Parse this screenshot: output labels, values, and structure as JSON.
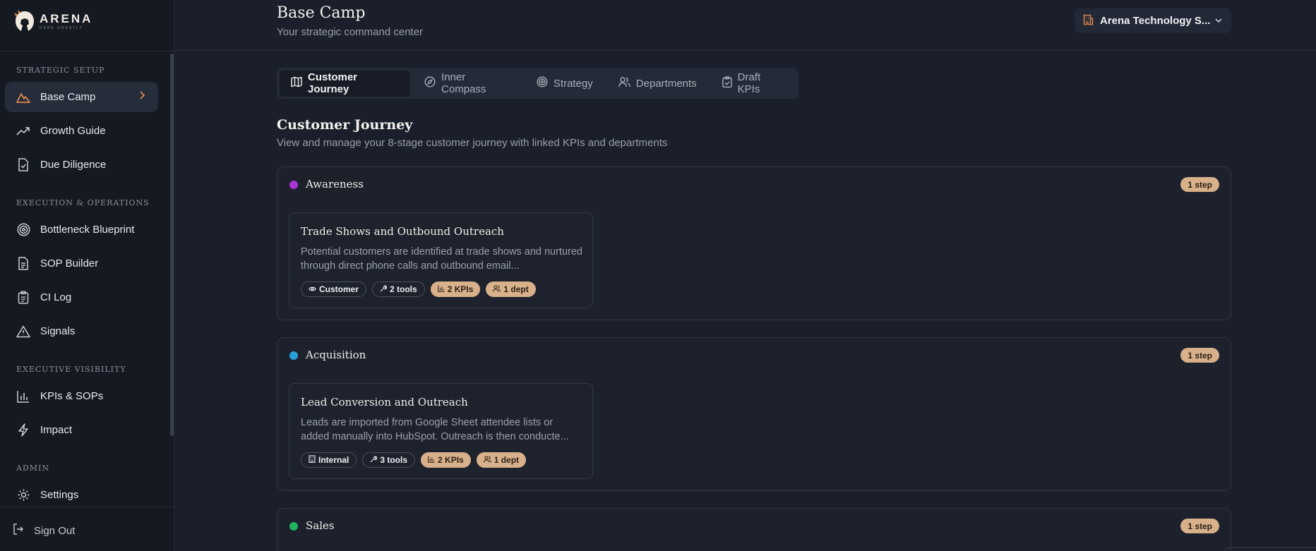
{
  "brand": {
    "name": "ARENA",
    "tagline": "DARE GREATLY"
  },
  "sidebar": {
    "sections": [
      {
        "label": "STRATEGIC SETUP"
      },
      {
        "label": "EXECUTION & OPERATIONS"
      },
      {
        "label": "EXECUTIVE VISIBILITY"
      },
      {
        "label": "ADMIN"
      }
    ],
    "items": [
      {
        "label": "Base Camp",
        "icon": "mountain-icon",
        "active": true
      },
      {
        "label": "Growth Guide",
        "icon": "trending-up-icon"
      },
      {
        "label": "Due Diligence",
        "icon": "file-check-icon"
      },
      {
        "label": "Bottleneck Blueprint",
        "icon": "target-icon"
      },
      {
        "label": "SOP Builder",
        "icon": "file-text-icon"
      },
      {
        "label": "CI Log",
        "icon": "clipboard-list-icon"
      },
      {
        "label": "Signals",
        "icon": "alert-triangle-icon"
      },
      {
        "label": "KPIs & SOPs",
        "icon": "bar-chart-icon"
      },
      {
        "label": "Impact",
        "icon": "zap-icon"
      },
      {
        "label": "Settings",
        "icon": "gear-icon"
      }
    ],
    "signout": "Sign Out"
  },
  "header": {
    "title": "Base Camp",
    "subtitle": "Your strategic command center",
    "org": "Arena Technology S..."
  },
  "tabs": [
    {
      "label": "Customer Journey",
      "icon": "map-icon",
      "active": true
    },
    {
      "label": "Inner Compass",
      "icon": "compass-icon"
    },
    {
      "label": "Strategy",
      "icon": "target-icon"
    },
    {
      "label": "Departments",
      "icon": "users-icon"
    },
    {
      "label": "Draft KPIs",
      "icon": "clipboard-check-icon"
    }
  ],
  "main": {
    "heading": "Customer Journey",
    "description": "View and manage your 8-stage customer journey with linked KPIs and departments",
    "stages": [
      {
        "name": "Awareness",
        "color": "#a935d6",
        "count": "1 step",
        "step": {
          "title": "Trade Shows and Outbound Outreach",
          "desc": "Potential customers are identified at trade shows and nurtured through direct phone calls and outbound email...",
          "chips": [
            "Customer",
            "2 tools",
            "2 KPIs",
            "1 dept"
          ]
        }
      },
      {
        "name": "Acquisition",
        "color": "#2b9fd9",
        "count": "1 step",
        "step": {
          "title": "Lead Conversion and Outreach",
          "desc": "Leads are imported from Google Sheet attendee lists or added manually into HubSpot. Outreach is then conducte...",
          "chips": [
            "Internal",
            "3 tools",
            "2 KPIs",
            "1 dept"
          ]
        }
      },
      {
        "name": "Sales",
        "color": "#22b35e",
        "count": "1 step"
      }
    ]
  }
}
